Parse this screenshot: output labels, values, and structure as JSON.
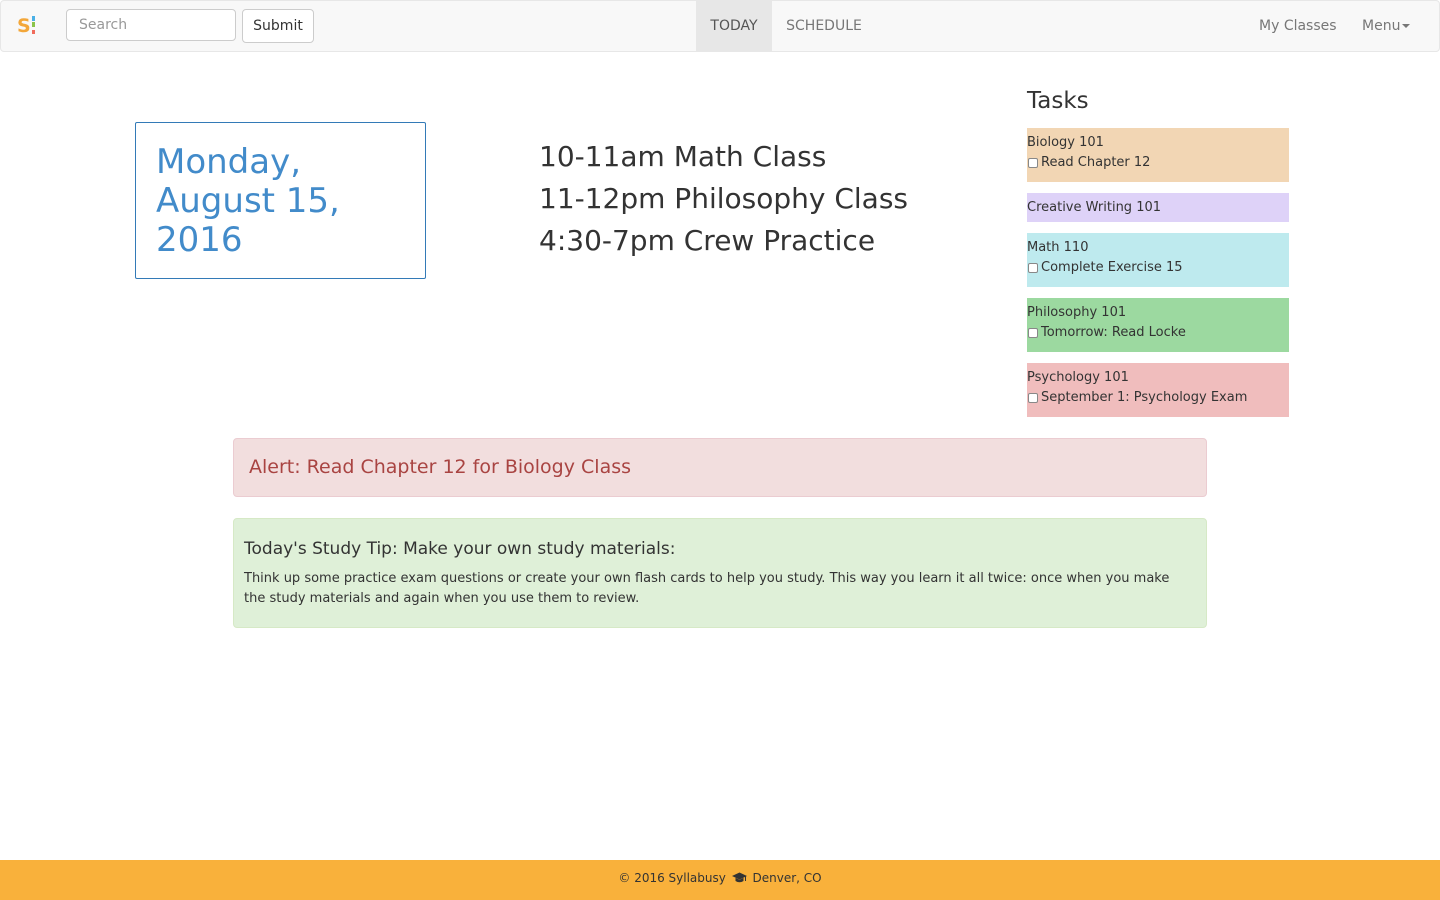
{
  "navbar": {
    "logo_text": "S",
    "search": {
      "placeholder": "Search",
      "value": ""
    },
    "submit_label": "Submit",
    "tabs": [
      {
        "label": "TODAY",
        "active": true
      },
      {
        "label": "SCHEDULE",
        "active": false
      }
    ],
    "my_classes_label": "My Classes",
    "menu_label": "Menu"
  },
  "date": {
    "text": "Monday, August 15, 2016"
  },
  "schedule": [
    "10-11am Math Class",
    "11-12pm Philosophy Class",
    "4:30-7pm Crew Practice"
  ],
  "tasks": {
    "title": "Tasks",
    "cards": [
      {
        "class_name": "Biology 101",
        "items": [
          "Read Chapter 12"
        ],
        "color": "#f2d6b4"
      },
      {
        "class_name": "Creative Writing 101",
        "items": [],
        "color": "#ded2f8"
      },
      {
        "class_name": "Math 110",
        "items": [
          "Complete Exercise 15"
        ],
        "color": "#beeaee"
      },
      {
        "class_name": "Philosophy 101",
        "items": [
          "Tomorrow: Read Locke"
        ],
        "color": "#9cd9a0"
      },
      {
        "class_name": "Psychology 101",
        "items": [
          "September 1: Psychology Exam"
        ],
        "color": "#f0bdbd"
      }
    ]
  },
  "alert": {
    "text": "Alert: Read Chapter 12 for Biology Class"
  },
  "tip": {
    "title": "Today's Study Tip: Make your own study materials:",
    "body": "Think up some practice exam questions or create your own flash cards to help you study. This way you learn it all twice: once when you make the study materials and again when you use them to review."
  },
  "footer": {
    "left_text": "© 2016 Syllabusy",
    "icon": "graduation-cap-icon",
    "right_text": "Denver, CO"
  },
  "colors": {
    "accent_blue": "#428bca",
    "footer_bg": "#f9b13b",
    "alert_text": "#a94442"
  }
}
